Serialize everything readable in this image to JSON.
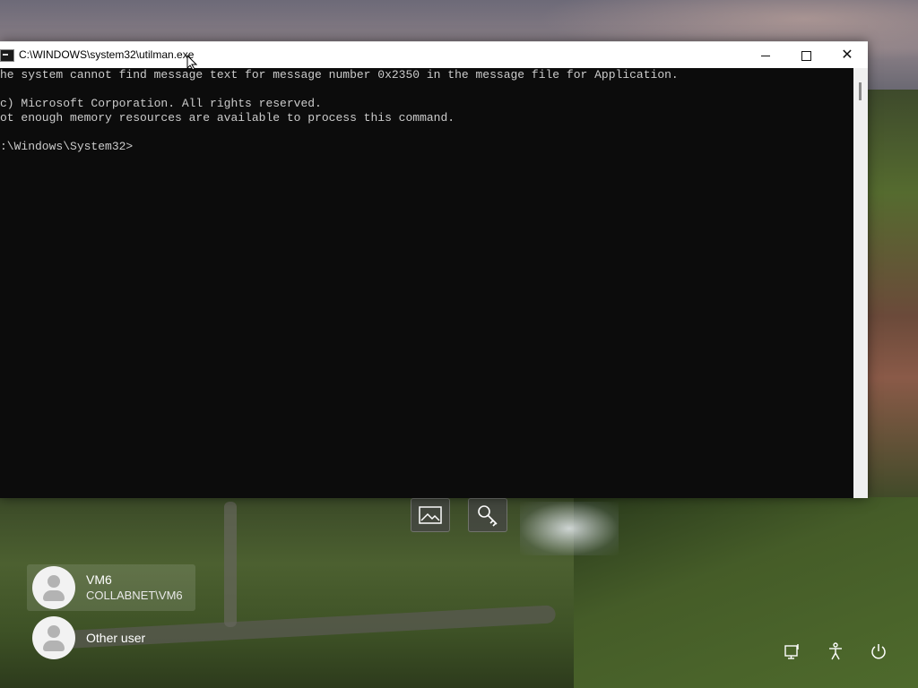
{
  "window": {
    "title": "C:\\WINDOWS\\system32\\utilman.exe",
    "icon": "console-icon",
    "controls": [
      "minimize-icon",
      "maximize-icon",
      "close-icon"
    ]
  },
  "console": {
    "lines": [
      "he system cannot find message text for message number 0x2350 in the message file for Application.",
      "",
      "c) Microsoft Corporation. All rights reserved.",
      "ot enough memory resources are available to process this command.",
      "",
      ":\\Windows\\System32>"
    ]
  },
  "lock_screen": {
    "tiles": [
      "image-icon",
      "key-icon"
    ],
    "users": [
      {
        "name": "VM6",
        "domain": "COLLABNET\\VM6"
      },
      {
        "name": "Other user",
        "domain": ""
      }
    ],
    "tray": [
      "network-icon",
      "accessibility-icon",
      "power-icon"
    ]
  },
  "colors": {
    "console_bg": "#0c0c0c",
    "console_text": "#cccccc",
    "titlebar_bg": "#ffffff"
  }
}
